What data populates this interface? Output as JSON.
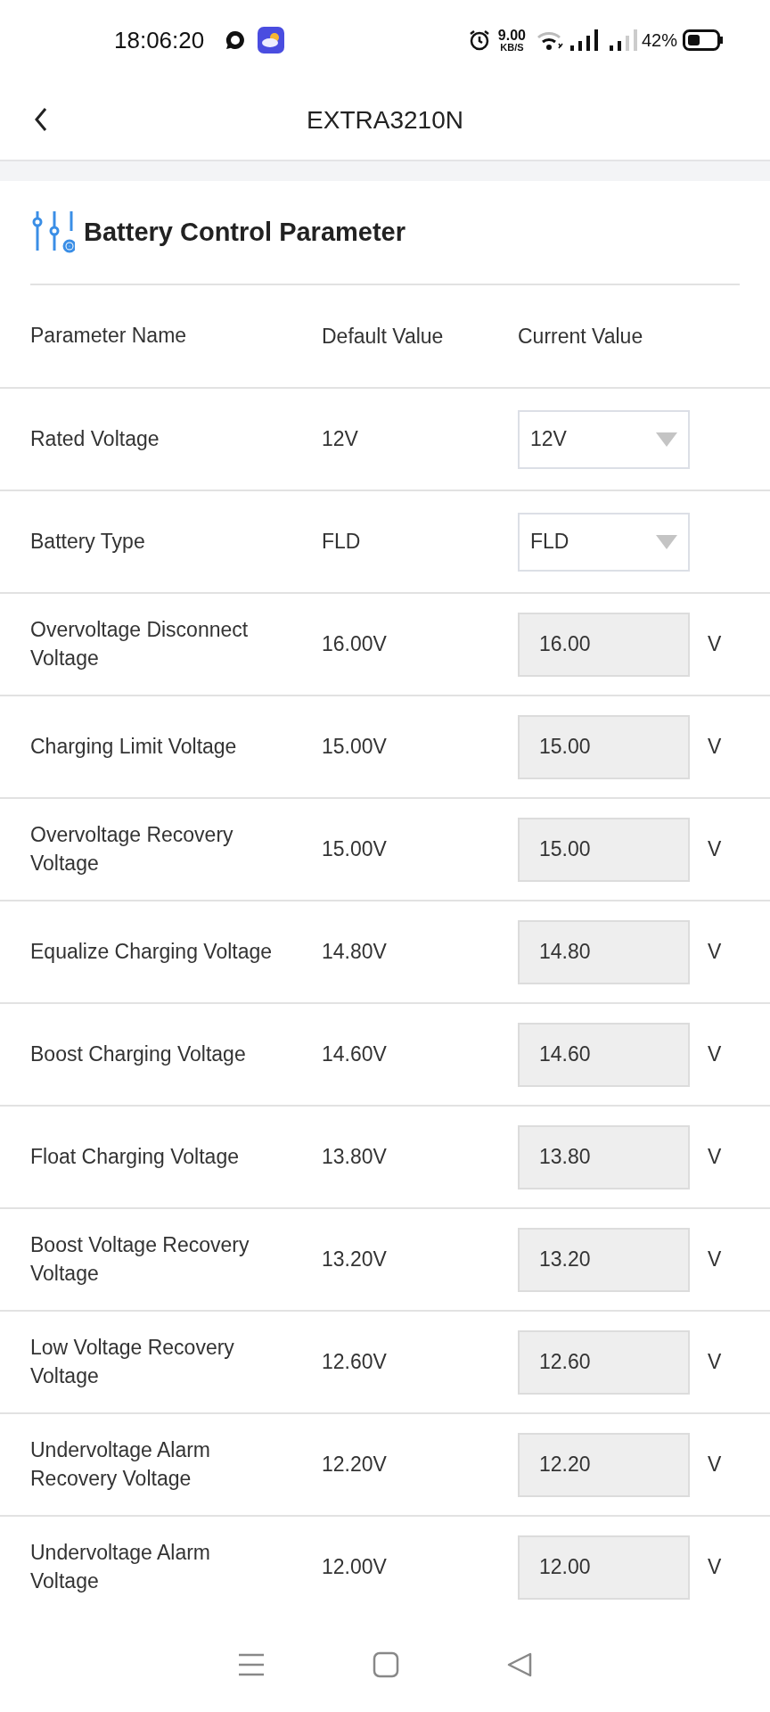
{
  "status_bar": {
    "time": "18:06:20",
    "net_speed": "9.00",
    "net_unit": "KB/S",
    "battery": "42%"
  },
  "header": {
    "title": "EXTRA3210N"
  },
  "section": {
    "title": "Battery Control Parameter"
  },
  "table": {
    "columns": [
      "Parameter Name",
      "Default Value",
      "Current Value"
    ],
    "rows": [
      {
        "kind": "select",
        "name": "Rated Voltage",
        "default": "12V",
        "value": "12V"
      },
      {
        "kind": "select",
        "name": "Battery Type",
        "default": "FLD",
        "value": "FLD"
      },
      {
        "kind": "input",
        "name": "Overvoltage Disconnect Voltage",
        "default": "16.00V",
        "value": "16.00",
        "unit": "V"
      },
      {
        "kind": "input",
        "name": "Charging Limit Voltage",
        "default": "15.00V",
        "value": "15.00",
        "unit": "V"
      },
      {
        "kind": "input",
        "name": "Overvoltage Recovery Voltage",
        "default": "15.00V",
        "value": "15.00",
        "unit": "V"
      },
      {
        "kind": "input",
        "name": "Equalize Charging Voltage",
        "default": "14.80V",
        "value": "14.80",
        "unit": "V"
      },
      {
        "kind": "input",
        "name": "Boost Charging Voltage",
        "default": "14.60V",
        "value": "14.60",
        "unit": "V"
      },
      {
        "kind": "input",
        "name": "Float Charging Voltage",
        "default": "13.80V",
        "value": "13.80",
        "unit": "V"
      },
      {
        "kind": "input",
        "name": "Boost Voltage Recovery Voltage",
        "default": "13.20V",
        "value": "13.20",
        "unit": "V"
      },
      {
        "kind": "input",
        "name": "Low Voltage Recovery Voltage",
        "default": "12.60V",
        "value": "12.60",
        "unit": "V"
      },
      {
        "kind": "input",
        "name": "Undervoltage Alarm Recovery Voltage",
        "default": "12.20V",
        "value": "12.20",
        "unit": "V"
      },
      {
        "kind": "input",
        "name": "Undervoltage Alarm Voltage",
        "default": "12.00V",
        "value": "12.00",
        "unit": "V"
      }
    ]
  }
}
